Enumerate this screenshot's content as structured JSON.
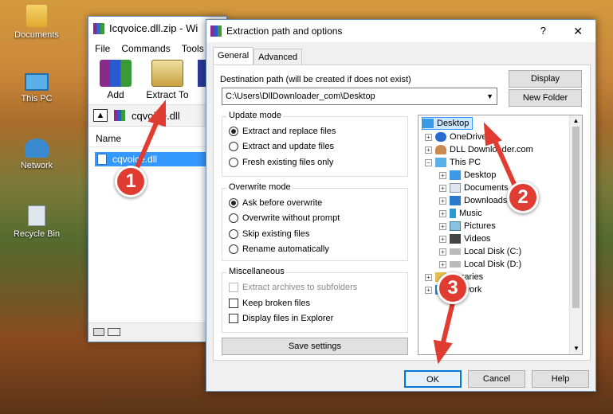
{
  "desktop": {
    "icons": [
      {
        "label": "Documents"
      },
      {
        "label": "This PC"
      },
      {
        "label": "Network"
      },
      {
        "label": "Recycle Bin"
      }
    ]
  },
  "winrar": {
    "title": "Icqvoice.dll.zip - Wi",
    "menu": [
      "File",
      "Commands",
      "Tools"
    ],
    "toolbar": {
      "add": "Add",
      "extract_to": "Extract To"
    },
    "path": "cqvoice.dll",
    "col_name": "Name",
    "file": "cqvoice.dll"
  },
  "dialog": {
    "title": "Extraction path and options",
    "help": "?",
    "close": "✕",
    "tabs": [
      "General",
      "Advanced"
    ],
    "dest_label": "Destination path (will be created if does not exist)",
    "dest_value": "C:\\Users\\DllDownloader_com\\Desktop",
    "display_btn": "Display",
    "new_folder_btn": "New Folder",
    "update_mode": {
      "legend": "Update mode",
      "options": [
        "Extract and replace files",
        "Extract and update files",
        "Fresh existing files only"
      ]
    },
    "overwrite_mode": {
      "legend": "Overwrite mode",
      "options": [
        "Ask before overwrite",
        "Overwrite without prompt",
        "Skip existing files",
        "Rename automatically"
      ]
    },
    "misc": {
      "legend": "Miscellaneous",
      "options": [
        "Extract archives to subfolders",
        "Keep broken files",
        "Display files in Explorer"
      ]
    },
    "save_settings": "Save settings",
    "tree": [
      "Desktop",
      "OneDrive",
      "DLL Downloader.com",
      "This PC",
      "Desktop",
      "Documents",
      "Downloads",
      "Music",
      "Pictures",
      "Videos",
      "Local Disk (C:)",
      "Local Disk (D:)",
      "Libraries",
      "Network"
    ],
    "ok": "OK",
    "cancel": "Cancel",
    "help_btn": "Help"
  },
  "callouts": [
    "1",
    "2",
    "3"
  ],
  "colors": {
    "selection": "#3399ff",
    "callout": "#e03c31"
  }
}
